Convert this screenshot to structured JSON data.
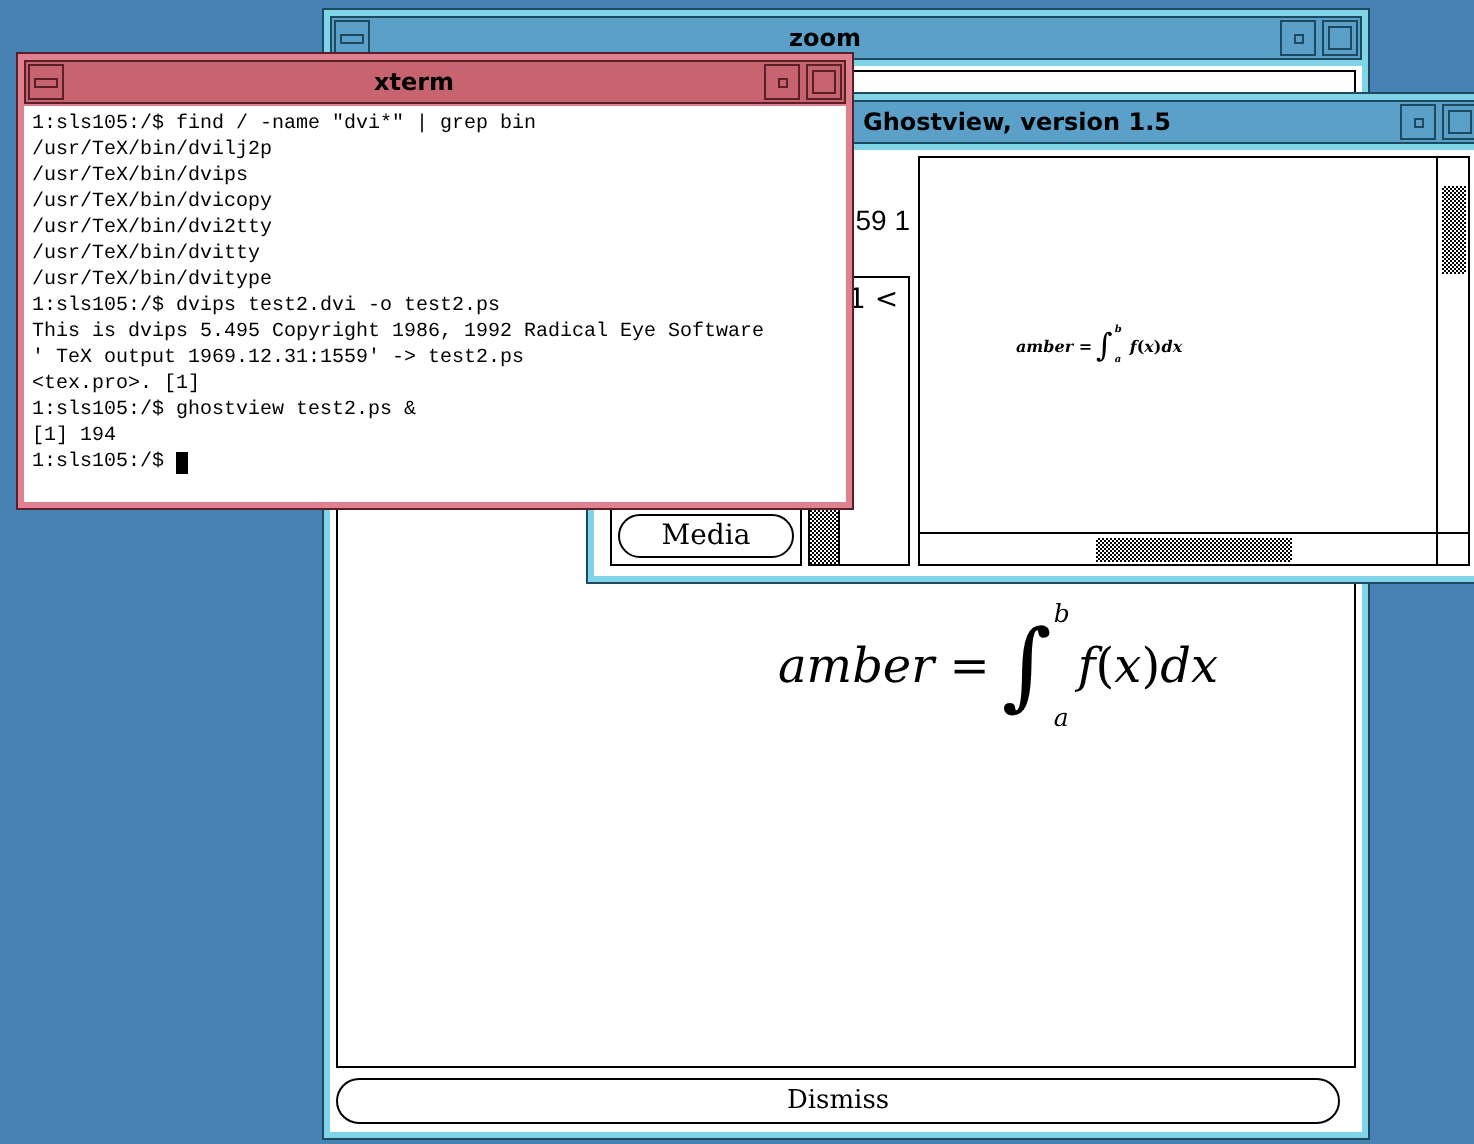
{
  "zoom_window": {
    "title": "zoom",
    "focused": false,
    "formula": "*amber* =",
    "integral": "∫",
    "lower": "a",
    "upper": "b",
    "formula_tail": "*f*(*x*)*dx*",
    "dismiss_button": "Dismiss"
  },
  "ghostview_window": {
    "title": "Ghostview, version 1.5",
    "focused": false,
    "page_info": "59 1",
    "page_list": [
      "1 <"
    ],
    "media_button": "Media",
    "formula": "*amber* =",
    "integral": "∫",
    "lower": "a",
    "upper": "b",
    "formula_tail": "*f*(*x*)*dx*"
  },
  "xterm_window": {
    "title": "xterm",
    "focused": true,
    "lines": [
      "1:sls105:/$ find / -name \"dvi*\" | grep bin",
      "/usr/TeX/bin/dvilj2p",
      "/usr/TeX/bin/dvips",
      "/usr/TeX/bin/dvicopy",
      "/usr/TeX/bin/dvi2tty",
      "/usr/TeX/bin/dvitty",
      "/usr/TeX/bin/dvitype",
      "1:sls105:/$ dvips test2.dvi -o test2.ps",
      "This is dvips 5.495 Copyright 1986, 1992 Radical Eye Software",
      "' TeX output 1969.12.31:1559' -> test2.ps",
      "<tex.pro>. [1]",
      "1:sls105:/$ ghostview test2.ps &",
      "[1] 194",
      "1:sls105:/$ "
    ]
  }
}
